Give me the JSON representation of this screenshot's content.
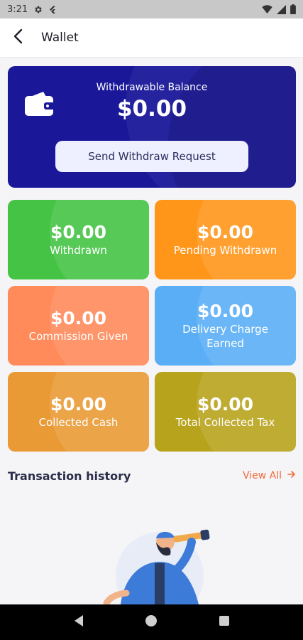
{
  "status_bar": {
    "time": "3:21",
    "icons": [
      "gear-icon",
      "flutter-icon",
      "wifi-icon",
      "signal-icon",
      "battery-icon"
    ]
  },
  "app_bar": {
    "title": "Wallet",
    "back_icon": "arrow-left-icon"
  },
  "balance_card": {
    "label": "Withdrawable Balance",
    "amount": "$0.00",
    "button_label": "Send Withdraw Request",
    "icon": "wallet-icon",
    "color": "#1a1899"
  },
  "stats": [
    {
      "amount": "$0.00",
      "label": "Withdrawn",
      "color": "#44c344"
    },
    {
      "amount": "$0.00",
      "label": "Pending Withdrawn",
      "color": "#ff961a"
    },
    {
      "amount": "$0.00",
      "label": "Commission Given",
      "color": "#ff8a5a"
    },
    {
      "amount": "$0.00",
      "label": "Delivery Charge Earned",
      "color": "#5aaef5"
    },
    {
      "amount": "$0.00",
      "label": "Collected Cash",
      "color": "#ea9a35"
    },
    {
      "amount": "$0.00",
      "label": "Total Collected Tax",
      "color": "#b8a31c"
    }
  ],
  "transaction_history": {
    "title": "Transaction history",
    "view_all": "View All",
    "accent": "#f26b3a"
  },
  "empty_state": {
    "illustration": "person-with-telescope-illustration"
  },
  "nav_bar": {
    "buttons": [
      "back-triangle-icon",
      "home-circle-icon",
      "recents-square-icon"
    ]
  }
}
